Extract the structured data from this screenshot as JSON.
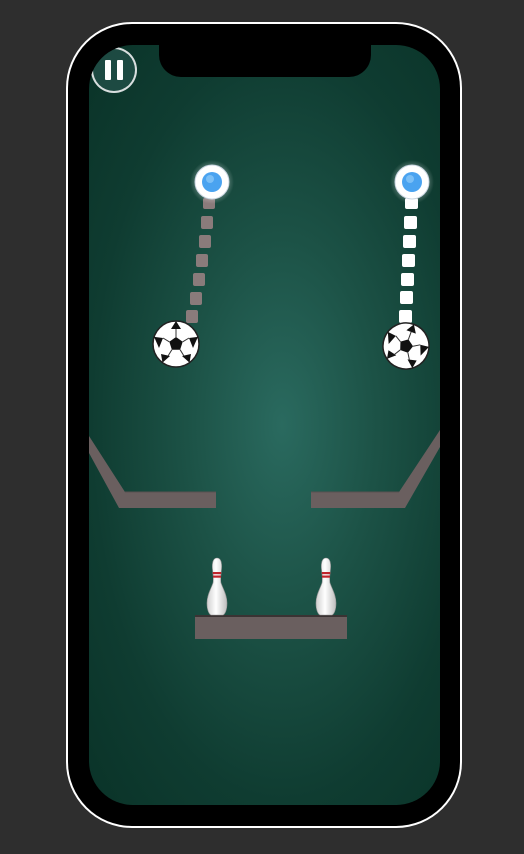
{
  "game": {
    "pause_label": "",
    "colors": {
      "background": "#2e2e2e",
      "phone_frame": "#000000",
      "board": "#1c5246",
      "platform": "#6a5f5f",
      "anchor_center": "#4aa3f0",
      "chain_left": "#8a7b7b",
      "chain_right": "#ffffff"
    },
    "pendulums": [
      {
        "id": "left",
        "chain_color": "chain_left",
        "ball": "soccer-ball"
      },
      {
        "id": "right",
        "chain_color": "chain_right",
        "ball": "soccer-ball"
      }
    ],
    "pins": {
      "count": 2
    }
  }
}
